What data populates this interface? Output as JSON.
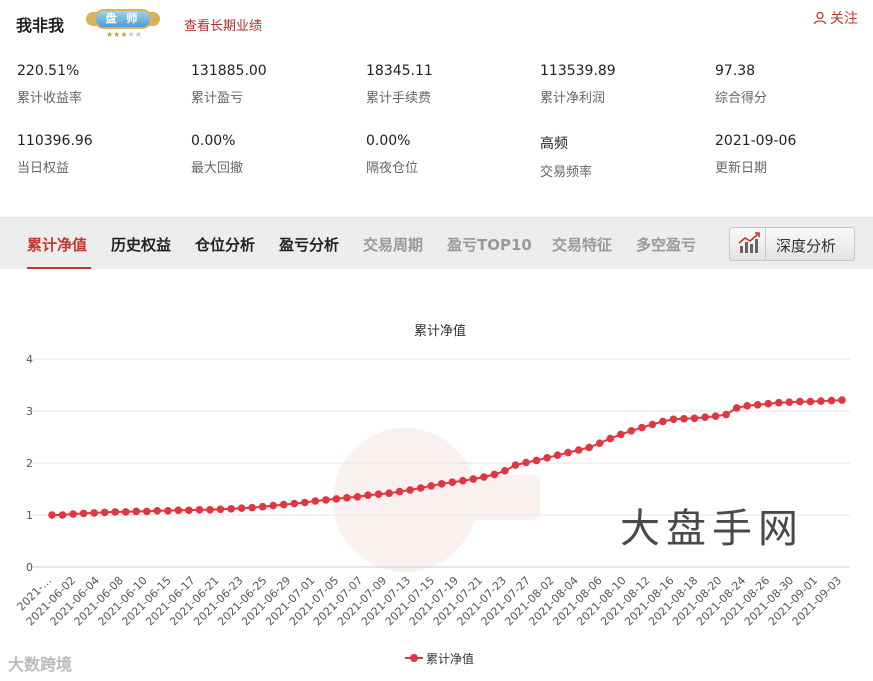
{
  "header": {
    "trader_name": "我非我",
    "badge_text": "盘 师",
    "badge_stars": "★★★",
    "badge_stars_dim": "★★",
    "long_term_link": "查看长期业绩",
    "follow_label": "关注"
  },
  "stats": [
    {
      "value": "220.51%",
      "label": "累计收益率"
    },
    {
      "value": "131885.00",
      "label": "累计盈亏"
    },
    {
      "value": "18345.11",
      "label": "累计手续费"
    },
    {
      "value": "113539.89",
      "label": "累计净利润"
    },
    {
      "value": "97.38",
      "label": "综合得分"
    },
    {
      "value": "110396.96",
      "label": "当日权益"
    },
    {
      "value": "0.00%",
      "label": "最大回撤"
    },
    {
      "value": "0.00%",
      "label": "隔夜仓位"
    },
    {
      "value": "高频",
      "label": "交易频率"
    },
    {
      "value": "2021-09-06",
      "label": "更新日期"
    }
  ],
  "tabs": [
    {
      "label": "累计净值",
      "state": "active"
    },
    {
      "label": "历史权益",
      "state": "normal"
    },
    {
      "label": "仓位分析",
      "state": "normal"
    },
    {
      "label": "盈亏分析",
      "state": "normal"
    },
    {
      "label": "交易周期",
      "state": "muted"
    },
    {
      "label": "盈亏TOP10",
      "state": "muted"
    },
    {
      "label": "交易特征",
      "state": "muted"
    },
    {
      "label": "多空盈亏",
      "state": "muted"
    }
  ],
  "deep_analysis_label": "深度分析",
  "watermark_text": "大盘手网",
  "watermark_bottom": "大数跨境",
  "colors": {
    "accent": "#c0392b",
    "series": "#e0363f",
    "grid": "#e6e6e6"
  },
  "chart_data": {
    "type": "line",
    "title": "累计净值",
    "ylim": [
      0,
      4
    ],
    "yticks": [
      0,
      1,
      2,
      3,
      4
    ],
    "grid": true,
    "legend": "bottom-center",
    "x_tick_labels": [
      "2021-…",
      "2021-06-02",
      "2021-06-04",
      "2021-06-08",
      "2021-06-10",
      "2021-06-15",
      "2021-06-17",
      "2021-06-21",
      "2021-06-23",
      "2021-06-25",
      "2021-06-29",
      "2021-07-01",
      "2021-07-05",
      "2021-07-07",
      "2021-07-09",
      "2021-07-13",
      "2021-07-15",
      "2021-07-19",
      "2021-07-21",
      "2021-07-23",
      "2021-07-27",
      "2021-08-02",
      "2021-08-04",
      "2021-08-06",
      "2021-08-10",
      "2021-08-12",
      "2021-08-16",
      "2021-08-18",
      "2021-08-20",
      "2021-08-24",
      "2021-08-26",
      "2021-08-30",
      "2021-09-01",
      "2021-09-03"
    ],
    "series": [
      {
        "name": "累计净值",
        "values": [
          1.0,
          1.0,
          1.02,
          1.03,
          1.04,
          1.05,
          1.06,
          1.06,
          1.07,
          1.07,
          1.08,
          1.08,
          1.09,
          1.09,
          1.1,
          1.1,
          1.11,
          1.12,
          1.13,
          1.14,
          1.16,
          1.18,
          1.2,
          1.22,
          1.24,
          1.27,
          1.29,
          1.31,
          1.33,
          1.35,
          1.38,
          1.4,
          1.42,
          1.45,
          1.48,
          1.52,
          1.56,
          1.6,
          1.63,
          1.66,
          1.69,
          1.73,
          1.78,
          1.85,
          1.96,
          2.01,
          2.05,
          2.1,
          2.15,
          2.2,
          2.25,
          2.3,
          2.38,
          2.47,
          2.55,
          2.62,
          2.68,
          2.74,
          2.8,
          2.84,
          2.85,
          2.86,
          2.88,
          2.9,
          2.93,
          3.06,
          3.1,
          3.12,
          3.14,
          3.16,
          3.17,
          3.18,
          3.18,
          3.19,
          3.2,
          3.21
        ]
      }
    ]
  }
}
